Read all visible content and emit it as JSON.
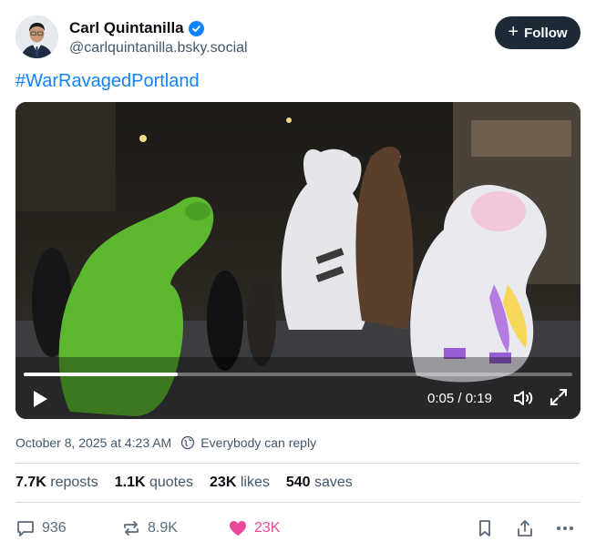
{
  "author": {
    "name": "Carl Quintanilla",
    "handle": "@carlquintanilla.bsky.social",
    "verified": true
  },
  "follow_label": "Follow",
  "post_text": "#WarRavagedPortland",
  "video": {
    "current_time": "0:05",
    "separator": "/",
    "duration": "0:19",
    "progress_fraction": 0.28
  },
  "meta": {
    "date": "October 8, 2025 at 4:23 AM",
    "reply_setting": "Everybody can reply"
  },
  "stats": {
    "reposts_count": "7.7K",
    "reposts_label": "reposts",
    "quotes_count": "1.1K",
    "quotes_label": "quotes",
    "likes_count": "23K",
    "likes_label": "likes",
    "saves_count": "540",
    "saves_label": "saves"
  },
  "actions": {
    "replies": "936",
    "reposts": "8.9K",
    "likes": "23K"
  },
  "colors": {
    "accent": "#1083fe",
    "like": "#ec4899",
    "follow_bg": "#1e2936",
    "muted": "#42576c"
  }
}
